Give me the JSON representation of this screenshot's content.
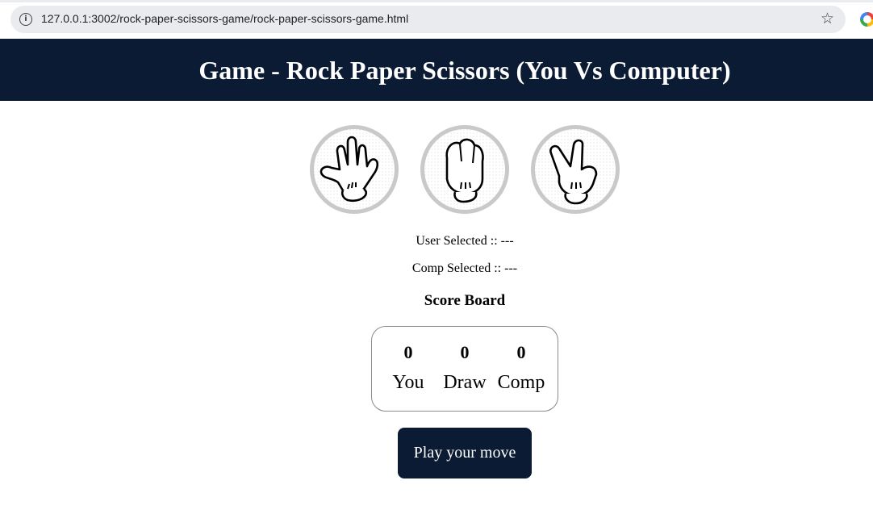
{
  "browser": {
    "url": "127.0.0.1:3002/rock-paper-scissors-game/rock-paper-scissors-game.html",
    "site_info_icon": "info-icon",
    "bookmark_icon": "star-icon",
    "extension_icon": "extension-icon"
  },
  "header": {
    "title": "Game - Rock Paper Scissors (You Vs Computer)",
    "background": "#0b1b33"
  },
  "choices": [
    {
      "name": "rock",
      "icon": "rock-hand-icon"
    },
    {
      "name": "paper",
      "icon": "paper-hand-icon"
    },
    {
      "name": "scissors",
      "icon": "scissors-hand-icon"
    }
  ],
  "status": {
    "user_selected": "User Selected :: ---",
    "comp_selected": "Comp Selected :: ---"
  },
  "score_board": {
    "heading": "Score Board",
    "columns": [
      {
        "value": "0",
        "label": "You"
      },
      {
        "value": "0",
        "label": "Draw"
      },
      {
        "value": "0",
        "label": "Comp"
      }
    ]
  },
  "play_button": {
    "label": "Play your move",
    "background": "#0b1b33"
  }
}
